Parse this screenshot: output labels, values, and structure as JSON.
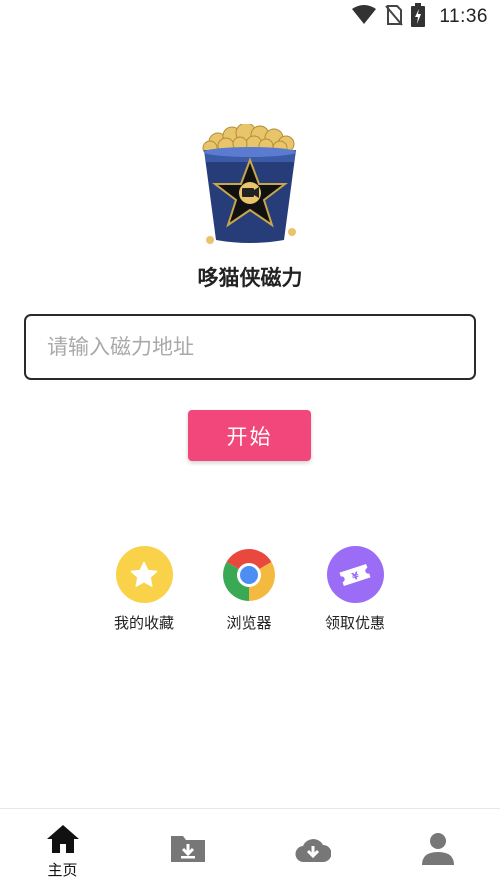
{
  "status_bar": {
    "time": "11:36",
    "icons": [
      "wifi-icon",
      "no-sim-icon",
      "battery-charging-icon"
    ]
  },
  "app": {
    "logo_icon": "popcorn-bucket-icon",
    "title": "哆猫侠磁力"
  },
  "search": {
    "placeholder": "请输入磁力地址",
    "value": ""
  },
  "start_button": {
    "label": "开始",
    "color": "#f2477a"
  },
  "quick_actions": [
    {
      "label": "我的收藏",
      "icon": "star-icon",
      "color": "#f9d24a"
    },
    {
      "label": "浏览器",
      "icon": "chrome-browser-icon",
      "color": "#4caf50"
    },
    {
      "label": "领取优惠",
      "icon": "coupon-ticket-icon",
      "color": "#9b6cf5"
    }
  ],
  "bottom_nav": {
    "items": [
      {
        "label": "主页",
        "icon": "home-icon",
        "active": true
      },
      {
        "label": "",
        "icon": "download-folder-icon",
        "active": false
      },
      {
        "label": "",
        "icon": "cloud-download-icon",
        "active": false
      },
      {
        "label": "",
        "icon": "person-icon",
        "active": false
      }
    ]
  }
}
